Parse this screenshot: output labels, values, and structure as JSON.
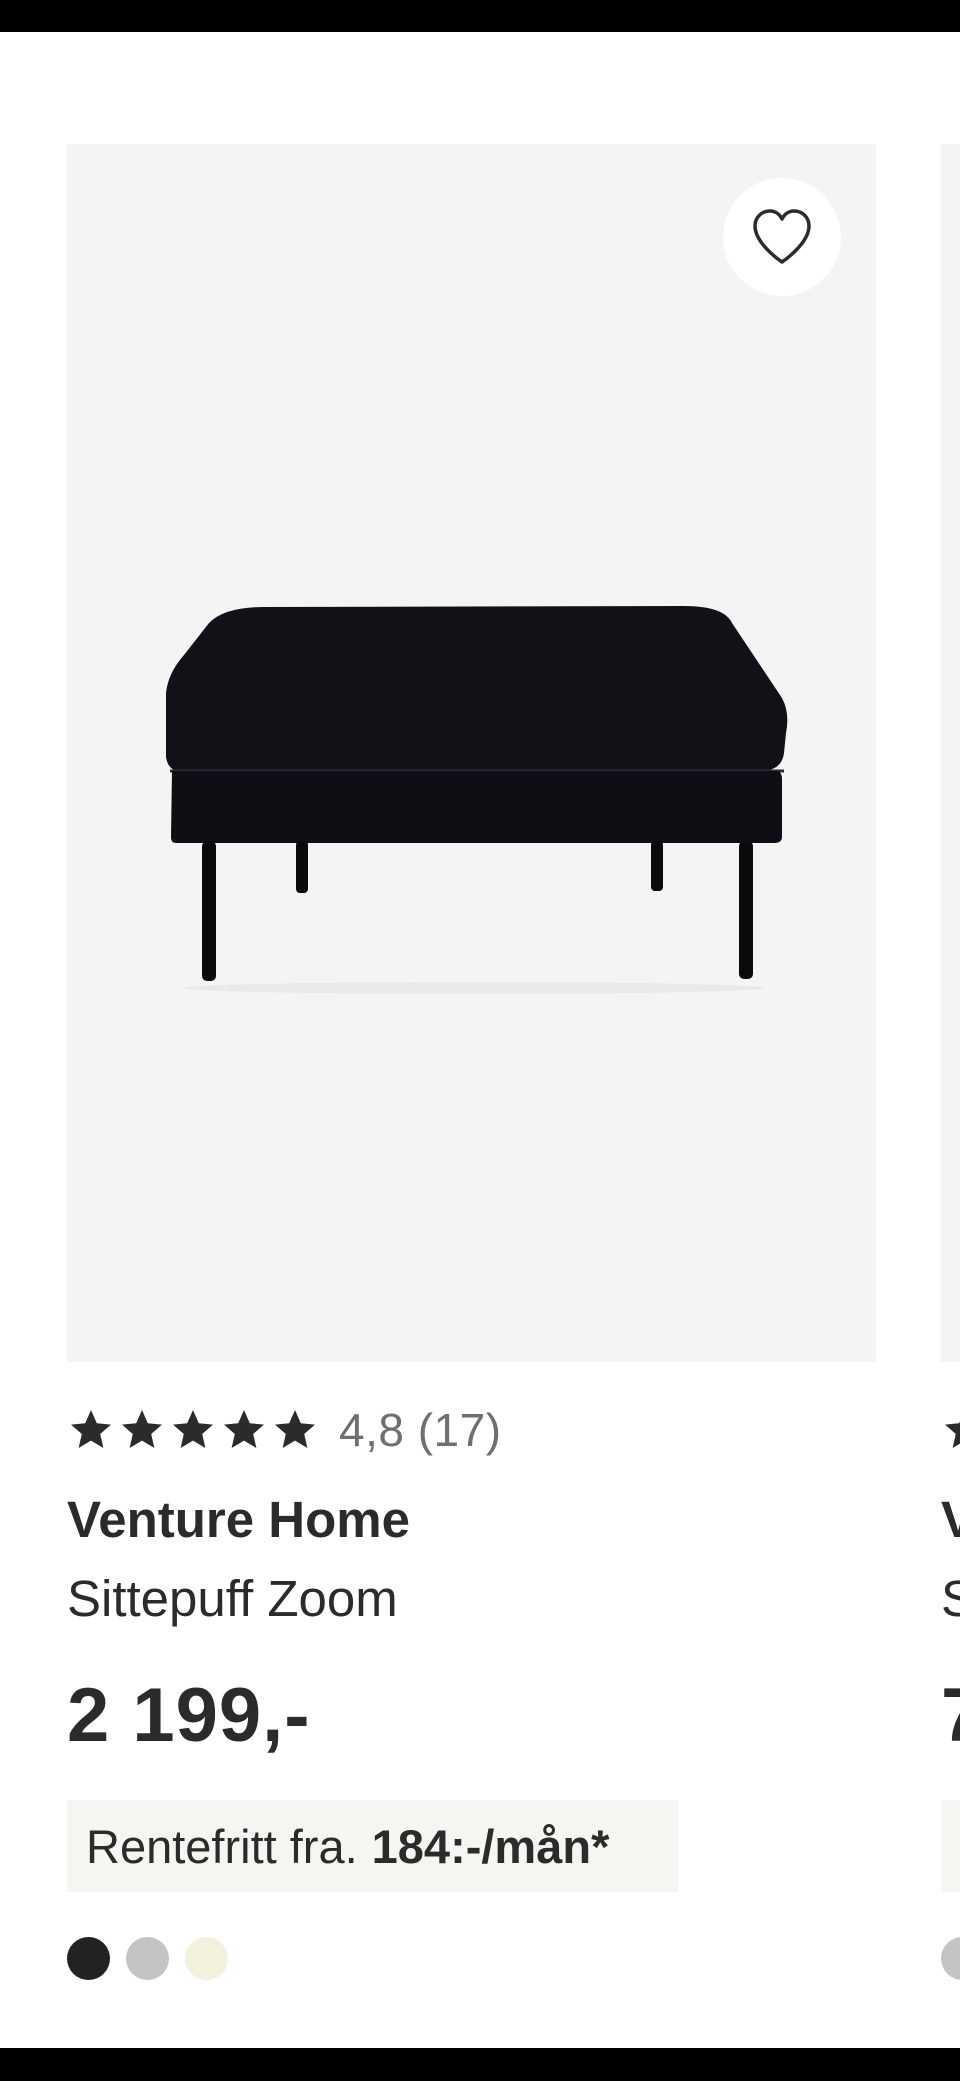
{
  "product": {
    "rating_value": "4,8",
    "rating_count": "(17)",
    "stars": 5,
    "brand": "Venture Home",
    "name": "Sittepuff Zoom",
    "price": "2 199,-",
    "finance_label": "Rentefritt fra.",
    "finance_amount": "184:-/mån*",
    "image_icon": "black-ottoman-image",
    "favorite_icon": "heart-outline-icon",
    "color_swatches": [
      "#222222",
      "#c4c4c4",
      "#f1f1dd"
    ]
  },
  "next_product": {
    "brand_initial": "V",
    "name_initial": "S",
    "price_initial": "7"
  }
}
